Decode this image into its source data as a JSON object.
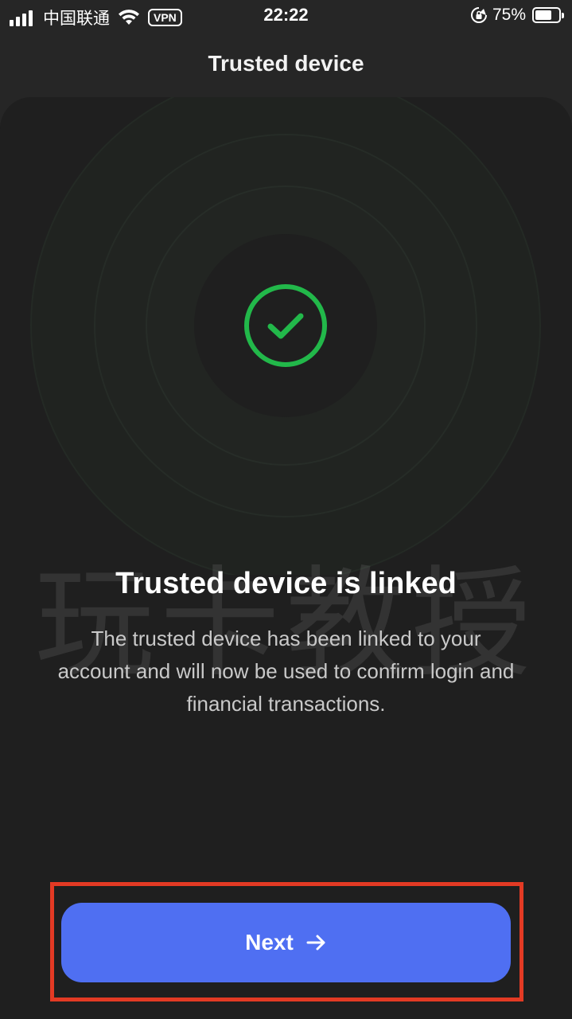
{
  "status_bar": {
    "carrier": "中国联通",
    "vpn": "VPN",
    "time": "22:22",
    "battery_percent": "75%",
    "battery_level": 0.75
  },
  "header": {
    "title": "Trusted device"
  },
  "main": {
    "icon": "check-circle-icon",
    "headline": "Trusted device is linked",
    "description": "The trusted device has been linked to your account and will now be used to confirm login and financial transactions.",
    "watermark": "玩卡教授"
  },
  "footer": {
    "next_label": "Next",
    "next_icon": "arrow-right-icon"
  },
  "colors": {
    "background": "#262626",
    "card": "#1f1f1f",
    "accent_green": "#22b84a",
    "button_blue": "#4f6ff2",
    "highlight_red": "#e33a24"
  }
}
